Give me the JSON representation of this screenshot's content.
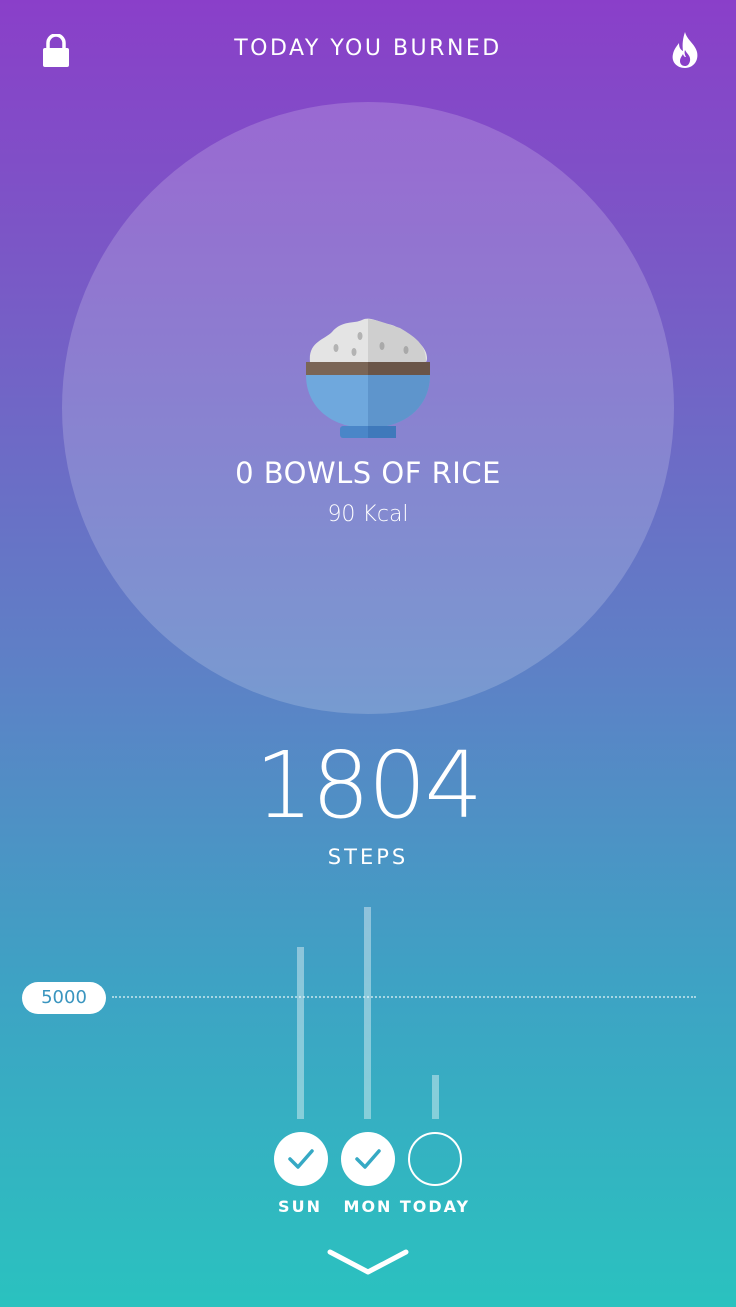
{
  "header": {
    "title": "TODAY YOU BURNED",
    "lock_icon": "lock-icon",
    "flame_icon": "flame-icon"
  },
  "equivalent": {
    "icon": "rice-bowl-icon",
    "label": "0 BOWLS OF RICE",
    "kcal": "90 Kcal"
  },
  "steps": {
    "value": "1804",
    "label": "STEPS"
  },
  "chart_data": {
    "type": "bar",
    "goal_label": "5000",
    "goal": 5000,
    "categories": [
      "SUN",
      "MON",
      "TODAY"
    ],
    "values": [
      7000,
      8600,
      1804
    ],
    "goal_met": [
      true,
      true,
      false
    ],
    "ylim": [
      0,
      9000
    ]
  },
  "colors": {
    "gradient_top": "#8a3fc9",
    "gradient_bottom": "#2ac2bf",
    "check_color": "#36a9c4",
    "goal_text": "#3a95bf"
  },
  "footer": {
    "chevron_icon": "chevron-down-icon"
  }
}
